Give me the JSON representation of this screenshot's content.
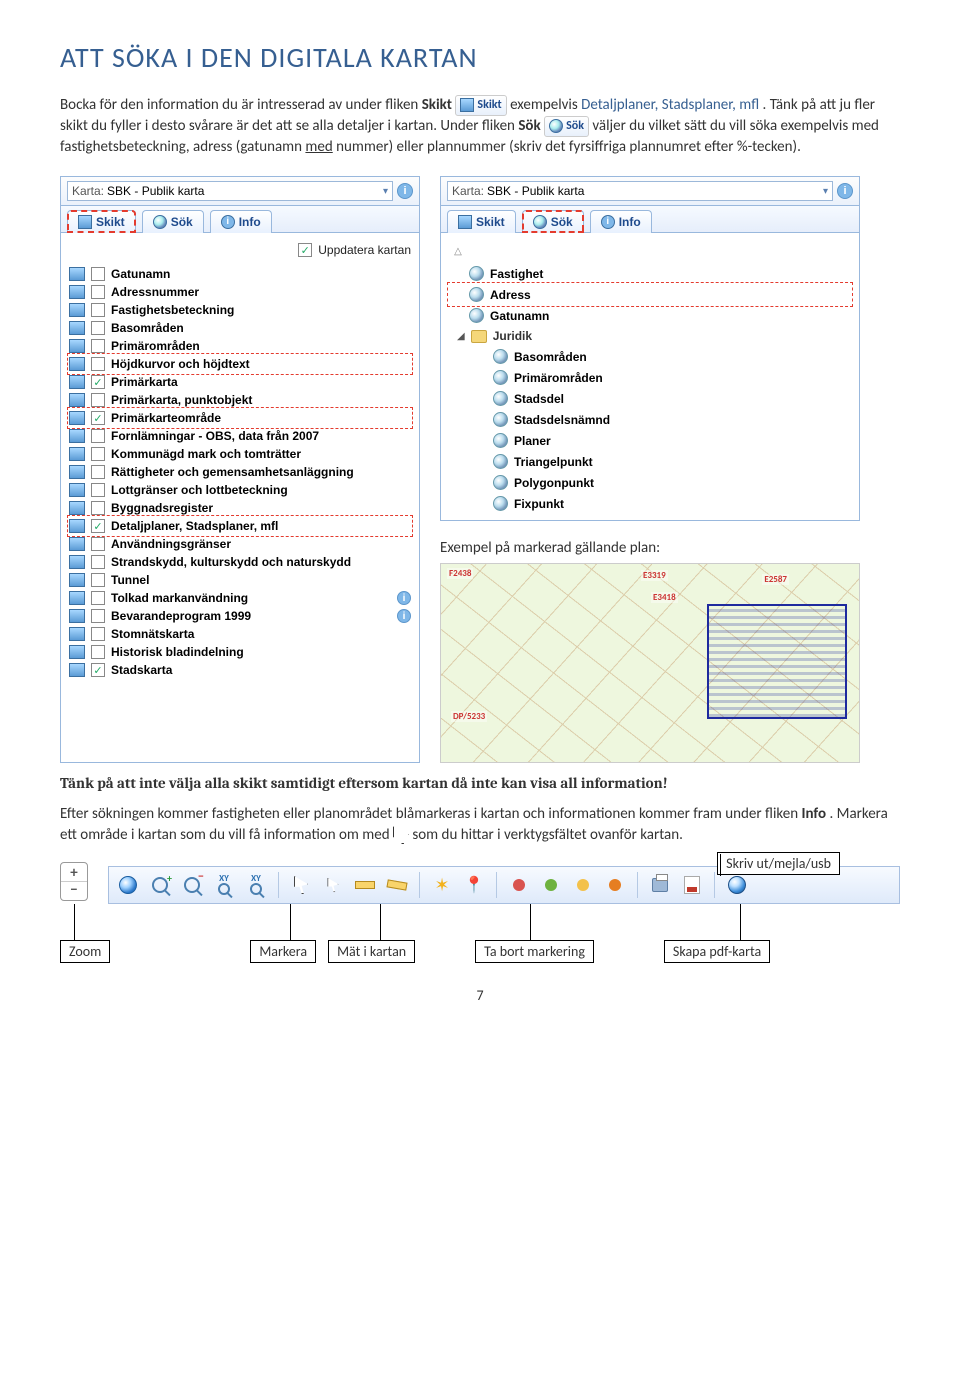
{
  "heading": "ATT SÖKA I DEN DIGITALA KARTAN",
  "para1a": "Bocka för den information du är intresserad av under fliken ",
  "para1b": "Skikt",
  "chipSkikt": "Skikt",
  "para1c": " exempelvis ",
  "para1d": "Detaljplaner, Stadsplaner, mfl",
  "para1e": ". Tänk på att ju fler skikt du fyller i desto svårare är det att se alla detaljer i kartan. Under fliken ",
  "para1f": "Sök",
  "chipSok": "Sök",
  "para1g": " väljer du vilket sätt du vill söka exempelvis med fastighetsbeteckning, adress (gatunamn ",
  "para1h": "med",
  "para1i": " nummer) eller plannummer (skriv det fyrsiffriga plannumret efter %-tecken).",
  "kartaLabel": "Karta:",
  "kartaValue": "SBK - Publik karta",
  "tabs": {
    "skikt": "Skikt",
    "sok": "Sök",
    "info": "Info"
  },
  "updateLabel": "Uppdatera kartan",
  "layers": [
    {
      "label": "Gatunamn",
      "checked": false
    },
    {
      "label": "Adressnummer",
      "checked": false
    },
    {
      "label": "Fastighetsbeteckning",
      "checked": false
    },
    {
      "label": "Basområden",
      "checked": false
    },
    {
      "label": "Primärområden",
      "checked": false
    },
    {
      "label": "Höjdkurvor och höjdtext",
      "checked": false,
      "hl": true
    },
    {
      "label": "Primärkarta",
      "checked": true
    },
    {
      "label": "Primärkarta, punktobjekt",
      "checked": false
    },
    {
      "label": "Primärkarteområde",
      "checked": true,
      "hl": true
    },
    {
      "label": "Fornlämningar - OBS, data från 2007",
      "checked": false
    },
    {
      "label": "Kommunägd mark och tomträtter",
      "checked": false
    },
    {
      "label": "Rättigheter och gemensamhetsanläggning",
      "checked": false
    },
    {
      "label": "Lottgränser och lottbeteckning",
      "checked": false
    },
    {
      "label": "Byggnadsregister",
      "checked": false
    },
    {
      "label": "Detaljplaner, Stadsplaner, mfl",
      "checked": true,
      "hl": true
    },
    {
      "label": "Användningsgränser",
      "checked": false
    },
    {
      "label": "Strandskydd, kulturskydd och naturskydd",
      "checked": false
    },
    {
      "label": "Tunnel",
      "checked": false
    },
    {
      "label": "Tolkad markanvändning",
      "checked": false,
      "info": true
    },
    {
      "label": "Bevarandeprogram 1999",
      "checked": false,
      "info": true
    },
    {
      "label": "Stomnätskarta",
      "checked": false
    },
    {
      "label": "Historisk bladindelning",
      "checked": false
    },
    {
      "label": "Stadskarta",
      "checked": true
    }
  ],
  "searchItems": {
    "top": [
      {
        "label": "Fastighet"
      },
      {
        "label": "Adress",
        "hl": true
      },
      {
        "label": "Gatunamn"
      }
    ],
    "folder": "Juridik",
    "sub": [
      {
        "label": "Basområden"
      },
      {
        "label": "Primärområden"
      },
      {
        "label": "Stadsdel"
      },
      {
        "label": "Stadsdelsnämnd"
      },
      {
        "label": "Planer"
      },
      {
        "label": "Triangelpunkt"
      },
      {
        "label": "Polygonpunkt"
      },
      {
        "label": "Fixpunkt"
      }
    ]
  },
  "exCaption": "Exempel på markerad gällande plan:",
  "mapLabels": {
    "a": "F2438",
    "b": "E3319",
    "c": "E2587",
    "d": "E3418",
    "e": "DP/5233"
  },
  "para2": "Tänk på att inte välja alla skikt samtidigt eftersom kartan då inte kan visa all information!",
  "para3a": "Efter sökningen kommer fastigheten eller planområdet blåmarkeras i kartan och informationen kommer fram under fliken ",
  "para3b": "Info",
  "para3c": ". Markera ett område i kartan som du vill få information om med ",
  "para3d": " som du hittar i verktygsfältet ovanför kartan.",
  "floatLabel": "Skriv ut/mejla/usb",
  "bLabels": {
    "zoom": "Zoom",
    "markera": "Markera",
    "mat": "Mät i kartan",
    "tabort": "Ta bort markering",
    "skapa": "Skapa pdf-karta"
  },
  "zoom": {
    "plus": "+",
    "minus": "−"
  },
  "page": "7"
}
